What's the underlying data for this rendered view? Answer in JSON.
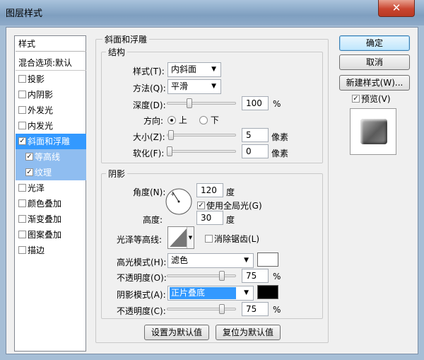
{
  "window": {
    "title": "图层样式",
    "close_glyph": "✕"
  },
  "sidebar": {
    "header": "样式",
    "blend_options": "混合选项:默认",
    "items": [
      {
        "label": "投影",
        "checked": false
      },
      {
        "label": "内阴影",
        "checked": false
      },
      {
        "label": "外发光",
        "checked": false
      },
      {
        "label": "内发光",
        "checked": false
      },
      {
        "label": "斜面和浮雕",
        "checked": true
      },
      {
        "label": "等高线",
        "checked": true
      },
      {
        "label": "纹理",
        "checked": true
      },
      {
        "label": "光泽",
        "checked": false
      },
      {
        "label": "颜色叠加",
        "checked": false
      },
      {
        "label": "渐变叠加",
        "checked": false
      },
      {
        "label": "图案叠加",
        "checked": false
      },
      {
        "label": "描边",
        "checked": false
      }
    ]
  },
  "bevel": {
    "title": "斜面和浮雕",
    "structure": {
      "title": "结构",
      "style_label": "样式(T):",
      "style_value": "内斜面",
      "technique_label": "方法(Q):",
      "technique_value": "平滑",
      "depth_label": "深度(D):",
      "depth_value": "100",
      "depth_unit": "%",
      "direction_label": "方向:",
      "dir_up": "上",
      "dir_down": "下",
      "size_label": "大小(Z):",
      "size_value": "5",
      "size_unit": "像素",
      "soften_label": "软化(F):",
      "soften_value": "0",
      "soften_unit": "像素"
    },
    "shading": {
      "title": "阴影",
      "angle_label": "角度(N):",
      "angle_value": "120",
      "angle_unit": "度",
      "global_light_label": "使用全局光(G)",
      "altitude_label": "高度:",
      "altitude_value": "30",
      "altitude_unit": "度",
      "gloss_label": "光泽等高线:",
      "antialias_label": "消除锯齿(L)",
      "highlight_mode_label": "高光模式(H):",
      "highlight_mode_value": "滤色",
      "highlight_opacity_label": "不透明度(O):",
      "highlight_opacity_value": "75",
      "highlight_opacity_unit": "%",
      "shadow_mode_label": "阴影模式(A):",
      "shadow_mode_value": "正片叠底",
      "shadow_opacity_label": "不透明度(C):",
      "shadow_opacity_value": "75",
      "shadow_opacity_unit": "%"
    },
    "make_default": "设置为默认值",
    "reset_default": "复位为默认值"
  },
  "actions": {
    "ok": "确定",
    "cancel": "取消",
    "new_style": "新建样式(W)...",
    "preview": "预览(V)"
  },
  "colors": {
    "highlight": "#ffffff",
    "shadow": "#000000",
    "selection": "#3399ff"
  }
}
